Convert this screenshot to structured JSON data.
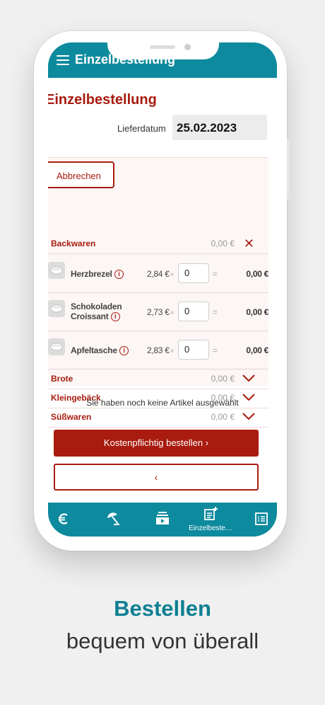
{
  "appbar": {
    "title": "Einzelbestellung"
  },
  "page": {
    "title": "Einzelbestellung",
    "date_label": "Lieferdatum",
    "date_value": "25.02.2023",
    "cancel_label": "Abbrechen"
  },
  "categories": {
    "backwaren": {
      "name": "Backwaren",
      "sum": "0,00 €",
      "state": "expanded"
    },
    "brote": {
      "name": "Brote",
      "sum": "0,00 €",
      "state": "collapsed"
    },
    "kleingebaeck": {
      "name": "Kleingebäck",
      "sum": "0,00 €",
      "state": "collapsed"
    },
    "suesswaren": {
      "name": "Süßwaren",
      "sum": "0,00 €",
      "state": "collapsed"
    }
  },
  "items": [
    {
      "name": "Herzbrezel",
      "price": "2,84 €",
      "mult": "×",
      "qty": "0",
      "eq": "=",
      "total": "0,00 €"
    },
    {
      "name_line1": "Schokoladen",
      "name_line2": "Croissant",
      "price": "2,73 €",
      "mult": "×",
      "qty": "0",
      "eq": "=",
      "total": "0,00 €"
    },
    {
      "name": "Apfeltasche",
      "price": "2,83 €",
      "mult": "×",
      "qty": "0",
      "eq": "=",
      "total": "0,00 €"
    }
  ],
  "info_glyph": "i",
  "empty_message": "Sie haben noch keine Artikel ausgewählt",
  "order_button": "Kostenpflichtig bestellen  ›",
  "back_button": "‹",
  "tabbar": [
    {
      "icon": "euro-icon",
      "label": ""
    },
    {
      "icon": "beach-umbrella-icon",
      "label": ""
    },
    {
      "icon": "media-stack-icon",
      "label": ""
    },
    {
      "icon": "note-add-icon",
      "label": "Einzelbeste…",
      "active": true
    },
    {
      "icon": "list-icon",
      "label": ""
    }
  ],
  "marketing": {
    "headline": "Bestellen",
    "subline": "bequem von überall"
  },
  "colors": {
    "brand_teal": "#0e8a9e",
    "accent_red": "#a81b0e",
    "background": "#f0f0f0"
  }
}
